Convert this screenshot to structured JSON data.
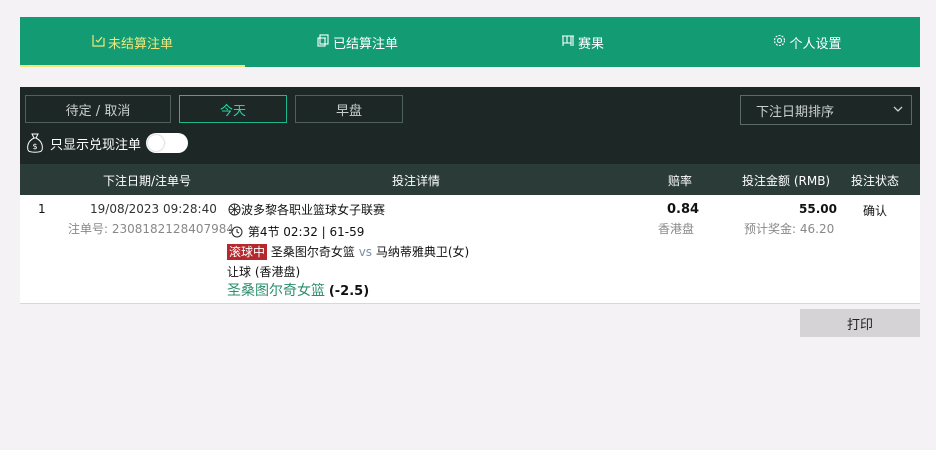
{
  "nav": {
    "tabs": [
      {
        "label": "未结算注单",
        "icon": "ticket-icon"
      },
      {
        "label": "已结算注单",
        "icon": "settled-icon"
      },
      {
        "label": "赛果",
        "icon": "results-icon"
      },
      {
        "label": "个人设置",
        "icon": "gear-icon"
      }
    ],
    "active_tab": 0
  },
  "filters": {
    "pending_label": "待定 / 取消",
    "today_label": "今天",
    "early_label": "早盘",
    "active": "今天",
    "sort_value": "下注日期排序",
    "cashout_label": "只显示兑现注单",
    "cashout_enabled": false
  },
  "table": {
    "headers": {
      "date": "下注日期/注单号",
      "details": "投注详情",
      "odds": "赔率",
      "stake": "投注金额 (RMB)",
      "status": "投注状态"
    },
    "rows": [
      {
        "index": "1",
        "datetime": "19/08/2023 09:28:40",
        "bet_no": "注单号: 2308182128407984",
        "league": "波多黎各职业篮球女子联赛",
        "period": "第4节 02:32 | 61-59",
        "live_badge": "滚球中",
        "home": "圣桑图尔奇女篮",
        "vs": "vs",
        "away": "马纳蒂雅典卫(女)",
        "market": "让球 (香港盘)",
        "selection": "圣桑图尔奇女篮",
        "handicap": "(-2.5)",
        "odds": "0.84",
        "odds_type": "香港盘",
        "stake": "55.00",
        "est_return": "预计奖金: 46.20",
        "status": "确认"
      }
    ]
  },
  "print_label": "打印",
  "colors": {
    "nav_bg": "#139c74",
    "active_accent": "#f2e67a",
    "filter_bg": "#1d2826",
    "header_bg": "#2b3c38",
    "live_badge": "#b5282e",
    "team_highlight": "#2a8f6e"
  }
}
